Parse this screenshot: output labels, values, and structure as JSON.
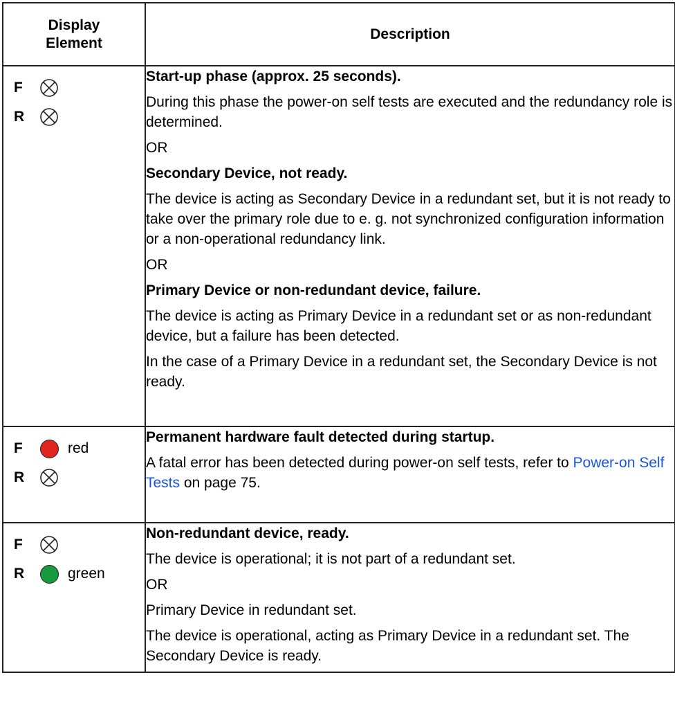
{
  "headers": {
    "display_element": "Display Element",
    "description": "Description"
  },
  "rows": [
    {
      "f_letter": "F",
      "r_letter": "R",
      "f_state": "off",
      "r_state": "off",
      "f_color_label": "",
      "r_color_label": "",
      "p1": "Start-up phase (approx. 25 seconds).",
      "p2": "During this phase the power-on self tests are executed and the redundancy role is determined.",
      "p3": "OR",
      "p4": "Secondary Device, not ready.",
      "p5": "The device is acting as Secondary Device in a redundant set, but it is not ready to take over the primary role due to e. g. not synchronized configuration information or a non-operational redundancy link.",
      "p6": "OR",
      "p7": "Primary Device or non-redundant device, failure.",
      "p8": "The device is acting as Primary Device in a redundant set or as non-redundant device, but a failure has been detected.",
      "p9": "In the case of a Primary Device in a redundant set, the Secondary Device is not ready."
    },
    {
      "f_letter": "F",
      "r_letter": "R",
      "f_state": "red",
      "r_state": "off",
      "f_color_label": "red",
      "r_color_label": "",
      "p1": "Permanent hardware fault detected during startup.",
      "p2_before": "A fatal error has been detected during power-on self tests, refer to ",
      "p2_link": "Power-on Self Tests",
      "p2_after": " on page 75."
    },
    {
      "f_letter": "F",
      "r_letter": "R",
      "f_state": "off",
      "r_state": "green",
      "f_color_label": "",
      "r_color_label": "green",
      "p1": "Non-redundant device, ready.",
      "p2": "The device is operational; it is not part of a redundant set.",
      "p3": "OR",
      "p4": "Primary Device in redundant set.",
      "p5": "The device is operational, acting as Primary Device in a redundant set. The Secondary Device is ready."
    }
  ],
  "colors": {
    "led_red": "#e0241f",
    "led_green": "#169a3c",
    "link": "#1a55e0",
    "border": "#222222"
  },
  "icons": {
    "off": "led-off-icon",
    "red": "led-red-icon",
    "green": "led-green-icon"
  }
}
